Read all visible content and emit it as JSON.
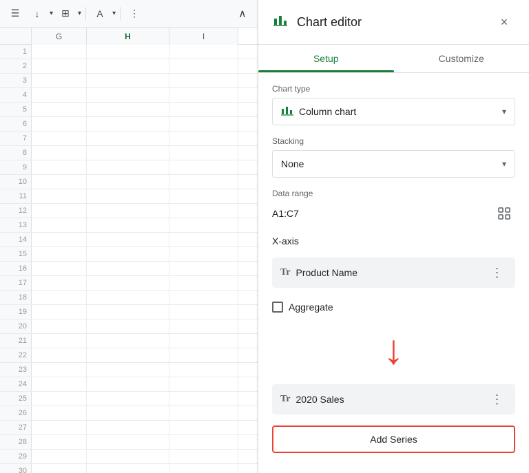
{
  "toolbar": {
    "icons": [
      "≡",
      "↓",
      "⊞",
      "A"
    ],
    "more_label": "⋮",
    "expand_label": "∧"
  },
  "spreadsheet": {
    "columns": [
      "G",
      "H",
      "I"
    ],
    "highlighted_col": "H",
    "row_count": 30
  },
  "chart_editor": {
    "title": "Chart editor",
    "panel_icon": "▥",
    "close_label": "×",
    "tabs": [
      {
        "id": "setup",
        "label": "Setup",
        "active": true
      },
      {
        "id": "customize",
        "label": "Customize",
        "active": false
      }
    ],
    "chart_type_label": "Chart type",
    "chart_type_value": "Column chart",
    "stacking_label": "Stacking",
    "stacking_value": "None",
    "data_range_label": "Data range",
    "data_range_value": "A1:C7",
    "x_axis_label": "X-axis",
    "x_axis_item": {
      "type_icon": "Tr",
      "label": "Product Name",
      "more": "⋮"
    },
    "aggregate_label": "Aggregate",
    "series_item": {
      "type_icon": "Tr",
      "label": "2020 Sales",
      "more": "⋮"
    },
    "add_series_label": "Add Series"
  }
}
